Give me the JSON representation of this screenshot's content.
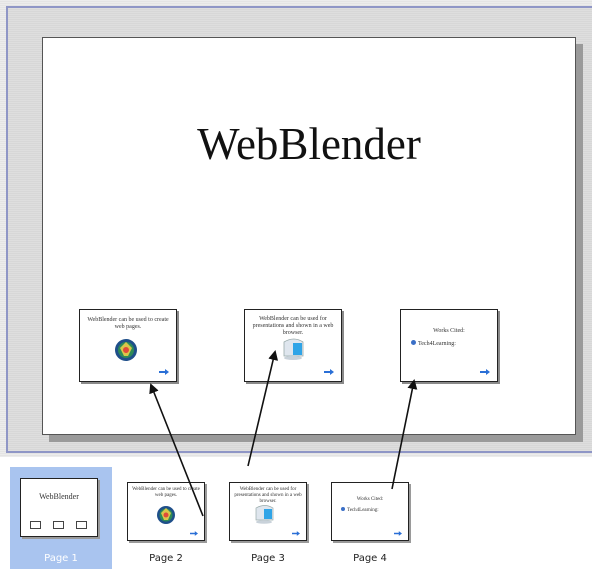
{
  "canvas": {
    "title": "WebBlender"
  },
  "slides": [
    {
      "text": "WebBlender can be used to create web pages."
    },
    {
      "text": "WebBlender can be used for presentations and shown in a web browser."
    },
    {
      "text": "Works Cited:",
      "item": "Tech4Learning:"
    }
  ],
  "pages": [
    {
      "label": "Page 1",
      "title": "WebBlender",
      "selected": true
    },
    {
      "label": "Page 2",
      "text": "WebBlender can be used to create web pages."
    },
    {
      "label": "Page 3",
      "text": "WebBlender can be used for presentations and shown in a web browser."
    },
    {
      "label": "Page 4",
      "text": "Works Cited:",
      "item": "Tech4Learning:"
    }
  ],
  "colors": {
    "selection": "#a9c4ef",
    "frame_border": "#8f96c6",
    "arrow_icon": "#2a6fd6"
  }
}
